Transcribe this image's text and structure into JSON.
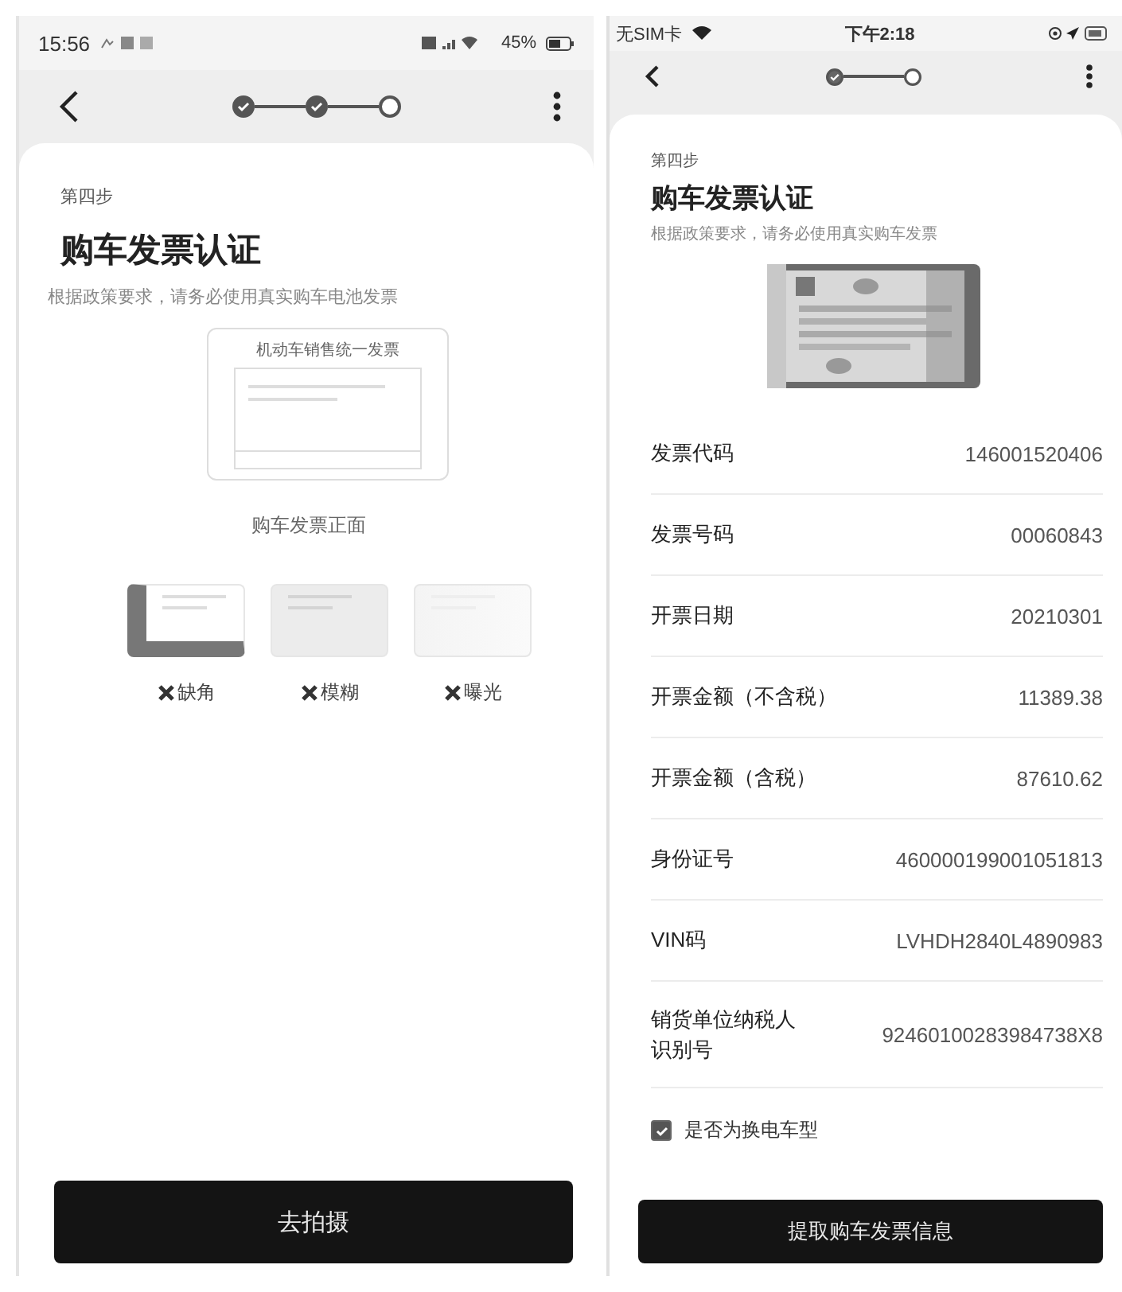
{
  "left_screen": {
    "status_bar": {
      "time": "15:56",
      "battery": "45%"
    },
    "stepper": [
      {
        "done": true
      },
      {
        "done": true
      },
      {
        "done": false
      }
    ],
    "step_label": "第四步",
    "title": "购车发票认证",
    "subtitle": "根据政策要求，请务必使用真实购车电池发票",
    "sample": {
      "heading": "机动车销售统一发票",
      "caption": "购车发票正面"
    },
    "bad_examples": [
      {
        "kind": "corner",
        "label": "缺角"
      },
      {
        "kind": "blur",
        "label": "模糊"
      },
      {
        "kind": "glare",
        "label": "曝光"
      }
    ],
    "button": "去拍摄"
  },
  "right_screen": {
    "status_bar": {
      "carrier": "无SIM卡",
      "time": "下午2:18"
    },
    "stepper": [
      {
        "done": true
      },
      {
        "done": false
      }
    ],
    "step_label": "第四步",
    "title": "购车发票认证",
    "subtitle": "根据政策要求，请务必使用真实购车发票",
    "fields": [
      {
        "label": "发票代码",
        "value": "146001520406"
      },
      {
        "label": "发票号码",
        "value": "00060843"
      },
      {
        "label": "开票日期",
        "value": "20210301"
      },
      {
        "label": "开票金额（不含税）",
        "value": "11389.38"
      },
      {
        "label": "开票金额（含税）",
        "value": "87610.62"
      },
      {
        "label": "身份证号",
        "value": "460000199001051813"
      },
      {
        "label": "VIN码",
        "value": "LVHDH2840L4890983"
      },
      {
        "label": "销货单位纳税人识别号",
        "value": "92460100283984738X8"
      }
    ],
    "checkbox": {
      "label": "是否为换电车型",
      "checked": true
    },
    "button": "提取购车发票信息"
  }
}
